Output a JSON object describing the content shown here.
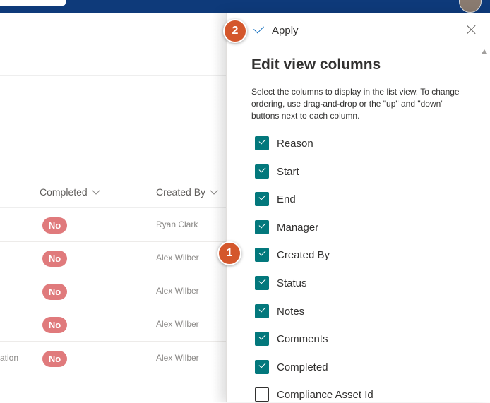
{
  "list": {
    "columns": {
      "completed": "Completed",
      "created_by": "Created By"
    },
    "rows": [
      {
        "status": "No",
        "created_by": "Ryan Clark",
        "truncated": ""
      },
      {
        "status": "No",
        "created_by": "Alex Wilber",
        "truncated": ""
      },
      {
        "status": "No",
        "created_by": "Alex Wilber",
        "truncated": ""
      },
      {
        "status": "No",
        "created_by": "Alex Wilber",
        "truncated": ""
      },
      {
        "status": "No",
        "created_by": "Alex Wilber",
        "truncated": "ation"
      }
    ]
  },
  "panel": {
    "apply_label": "Apply",
    "title": "Edit view columns",
    "description": "Select the columns to display in the list view. To change ordering, use drag-and-drop or the \"up\" and \"down\" buttons next to each column.",
    "columns": [
      {
        "label": "Reason",
        "checked": true
      },
      {
        "label": "Start",
        "checked": true
      },
      {
        "label": "End",
        "checked": true
      },
      {
        "label": "Manager",
        "checked": true
      },
      {
        "label": "Created By",
        "checked": true
      },
      {
        "label": "Status",
        "checked": true
      },
      {
        "label": "Notes",
        "checked": true
      },
      {
        "label": "Comments",
        "checked": true
      },
      {
        "label": "Completed",
        "checked": true
      },
      {
        "label": "Compliance Asset Id",
        "checked": false
      }
    ]
  },
  "callouts": {
    "one": "1",
    "two": "2"
  },
  "colors": {
    "suite_bar": "#0e3a7a",
    "checkbox_checked": "#03787c",
    "status_pill": "#e07a7c",
    "callout": "#d4572c"
  }
}
